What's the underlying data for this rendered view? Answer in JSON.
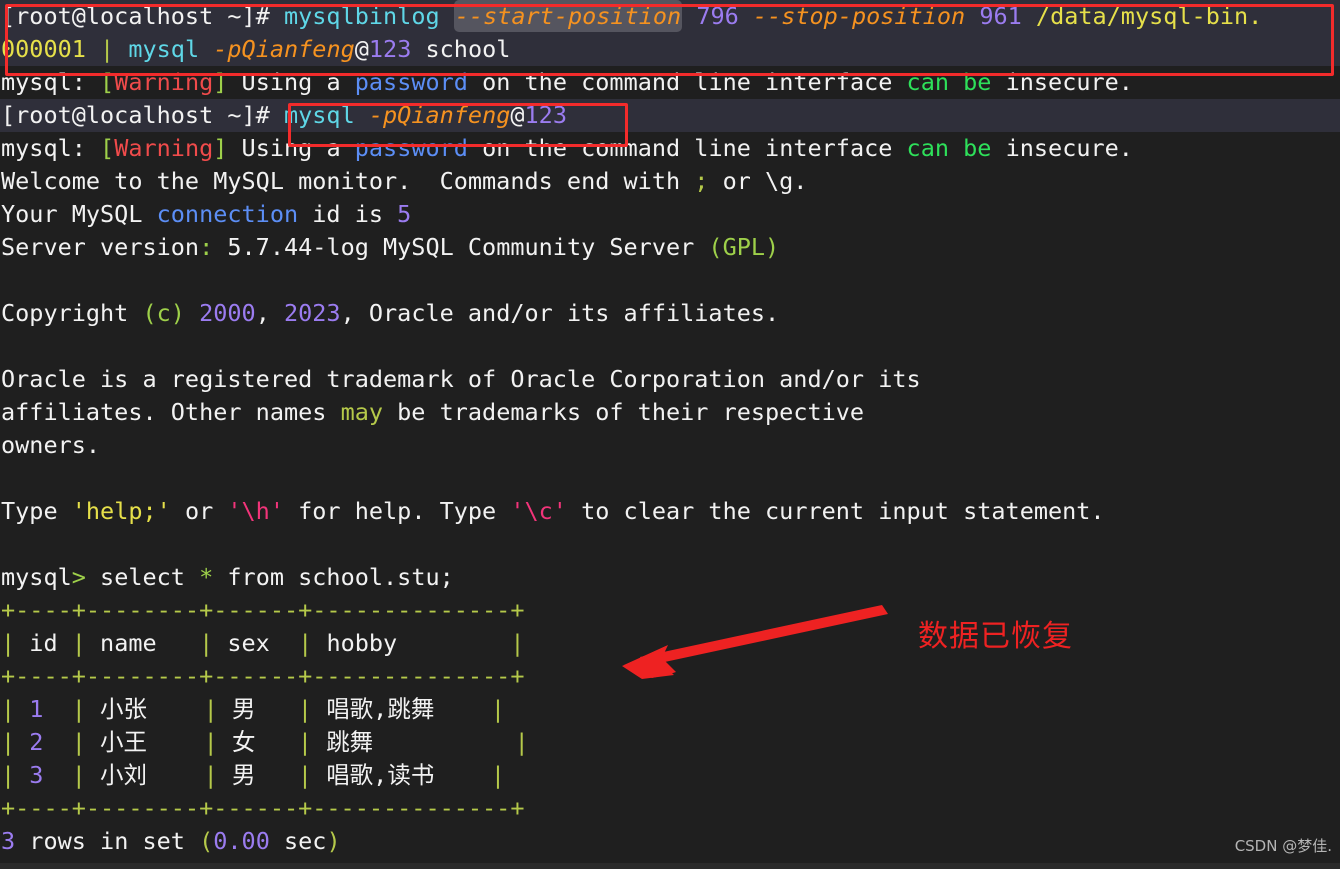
{
  "terminal": {
    "prompt": "[root@localhost ~]#",
    "mysql_prompt": "mysql>",
    "lines": [
      {
        "id": "cmd-mysqlbinlog-part1",
        "text": "[root@localhost ~]# mysqlbinlog --start-position 796 --stop-position 961 /data/mysql-bin."
      },
      {
        "id": "cmd-mysqlbinlog-part2",
        "text": "000001 | mysql -pQianfeng@123 school"
      },
      {
        "id": "warning-1",
        "text": "mysql: [Warning] Using a password on the command line interface can be insecure."
      },
      {
        "id": "cmd-mysql-login",
        "text": "[root@localhost ~]# mysql -pQianfeng@123"
      },
      {
        "id": "warning-2",
        "text": "mysql: [Warning] Using a password on the command line interface can be insecure."
      },
      {
        "id": "welcome",
        "text": "Welcome to the MySQL monitor.  Commands end with ; or \\g."
      },
      {
        "id": "connection-id",
        "text": "Your MySQL connection id is 5"
      },
      {
        "id": "server-version",
        "text": "Server version: 5.7.44-log MySQL Community Server (GPL)"
      },
      {
        "id": "copyright",
        "text": "Copyright (c) 2000, 2023, Oracle and/or its affiliates."
      },
      {
        "id": "trademark-1",
        "text": "Oracle is a registered trademark of Oracle Corporation and/or its"
      },
      {
        "id": "trademark-2",
        "text": "affiliates. Other names may be trademarks of their respective"
      },
      {
        "id": "trademark-3",
        "text": "owners."
      },
      {
        "id": "help-hint",
        "text": "Type 'help;' or '\\h' for help. Type '\\c' to clear the current input statement."
      },
      {
        "id": "sql-query",
        "text": "mysql> select * from school.stu;"
      }
    ],
    "command1": {
      "prompt": "[root@localhost ~]#",
      "program": "mysqlbinlog",
      "opt_start": "--start-position",
      "val_start": "796",
      "opt_stop": "--stop-position",
      "val_stop": "961",
      "path_part1": "/data/mysql-bin.",
      "path_part2": "000001",
      "pipe": "|",
      "program2": "mysql",
      "password_flag": "-pQianfeng",
      "at": "@",
      "password_num": "123",
      "database": "school"
    },
    "command2": {
      "prompt": "[root@localhost ~]#",
      "program": "mysql",
      "password_flag": "-pQianfeng",
      "at": "@",
      "password_num": "123"
    },
    "warning": {
      "prefix": "mysql: ",
      "bracket_open": "[",
      "label": "Warning",
      "bracket_close": "]",
      "mid1": " Using a ",
      "keyword": "password",
      "mid2": " on the command line interface ",
      "green1": "can",
      "space": " ",
      "green2": "be",
      "tail": " insecure."
    },
    "welcome": {
      "part1": "Welcome to the MySQL monitor.  Commands end with ",
      "semicolon": ";",
      "part2": " or \\g."
    },
    "connection": {
      "part1": "Your MySQL ",
      "keyword": "connection",
      "part2": " id is ",
      "id": "5"
    },
    "server": {
      "label": "Server version",
      "colon": ":",
      "version": " 5.7.44-log MySQL Community Server ",
      "gpl": "(GPL)"
    },
    "copyright": {
      "part1": "Copyright ",
      "c": "(c)",
      "space1": " ",
      "year1": "2000",
      "comma1": ", ",
      "year2": "2023",
      "part2": ", Oracle and/or its affiliates."
    },
    "trademark": {
      "line1": "Oracle is a registered trademark of Oracle Corporation and/or its",
      "line2a": "affiliates. Other names ",
      "may": "may",
      "line2b": " be trademarks of their respective",
      "line3": "owners."
    },
    "help": {
      "type1": "Type ",
      "help_cmd": "'help;'",
      "or": " or ",
      "h_cmd": "'\\h'",
      "mid": " for help. Type ",
      "c_cmd": "'\\c'",
      "tail": " to clear the current input statement."
    },
    "query": {
      "prompt": "mysql",
      "gt": ">",
      "part1": " select ",
      "star": "*",
      "part2": " from school.stu;"
    },
    "result_footer": {
      "rows": "3",
      "text1": " rows in set ",
      "paren_open": "(",
      "time": "0.00",
      "sec": " sec",
      "paren_close": ")"
    }
  },
  "chart_data": {
    "type": "table",
    "title": "select * from school.stu;",
    "separator": "+----+--------+------+--------------+",
    "columns": [
      "id",
      "name",
      "sex",
      "hobby"
    ],
    "header_row": "| id | name   | sex  | hobby        |",
    "rows": [
      {
        "id": "1",
        "name": "小张",
        "sex": "男",
        "hobby": "唱歌,跳舞"
      },
      {
        "id": "2",
        "name": "小王",
        "sex": "女",
        "hobby": "跳舞"
      },
      {
        "id": "3",
        "name": "小刘",
        "sex": "男",
        "hobby": "唱歌,读书"
      }
    ],
    "row_count": "3 rows in set (0.00 sec)"
  },
  "annotations": {
    "note_text": "数据已恢复",
    "note_color": "#ee2222",
    "arrow_color": "#ee2222",
    "box_color": "#f32b2b",
    "boxes": [
      {
        "name": "mysqlbinlog-command-box"
      },
      {
        "name": "mysql-login-command-box"
      }
    ]
  },
  "watermark": {
    "text": "CSDN @梦佳."
  }
}
